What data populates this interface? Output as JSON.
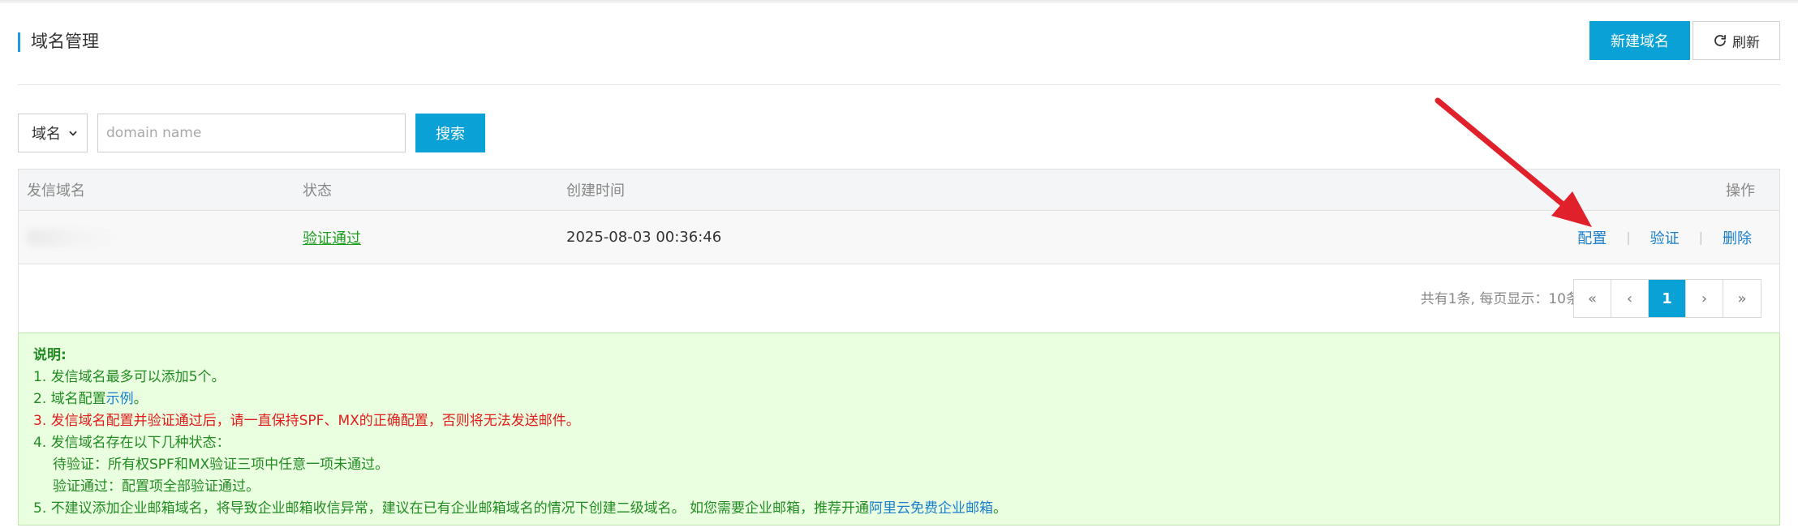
{
  "header": {
    "title": "域名管理",
    "new_button": "新建域名",
    "refresh_button": "刷新"
  },
  "search": {
    "select_value": "域名",
    "placeholder": "domain name",
    "button": "搜索"
  },
  "table": {
    "columns": [
      "发信域名",
      "状态",
      "创建时间",
      "操作"
    ],
    "rows": [
      {
        "domain": "",
        "status": "验证通过",
        "created": "2025-08-03 00:36:46",
        "actions": [
          "配置",
          "验证",
          "删除"
        ]
      }
    ]
  },
  "pager": {
    "info": "共有1条, 每页显示：10条",
    "first": "«",
    "prev": "‹",
    "current": "1",
    "next": "›",
    "last": "»"
  },
  "notes": {
    "head": "说明:",
    "line1": "1. 发信域名最多可以添加5个。",
    "line2_prefix": "2. 域名配置",
    "line2_link": "示例",
    "line2_suffix": "。",
    "line3": "3. 发信域名配置并验证通过后，请一直保持SPF、MX的正确配置，否则将无法发送邮件。",
    "line4": "4. 发信域名存在以下几种状态：",
    "line4a": "待验证：所有权SPF和MX验证三项中任意一项未通过。",
    "line4b": "验证通过：配置项全部验证通过。",
    "line5_prefix": "5. 不建议添加企业邮箱域名，将导致企业邮箱收信异常，建议在已有企业邮箱域名的情况下创建二级域名。 如您需要企业邮箱，推荐开通",
    "line5_link": "阿里云免费企业邮箱",
    "line5_suffix": "。"
  },
  "colors": {
    "primary": "#0aa1d7",
    "success_text": "#228b22",
    "warning_text": "#e21b1b",
    "link": "#1a7ecd",
    "annotation_arrow": "#e0202a"
  },
  "icons": {
    "refresh": "refresh-icon",
    "dropdown": "chevron-down-icon"
  }
}
